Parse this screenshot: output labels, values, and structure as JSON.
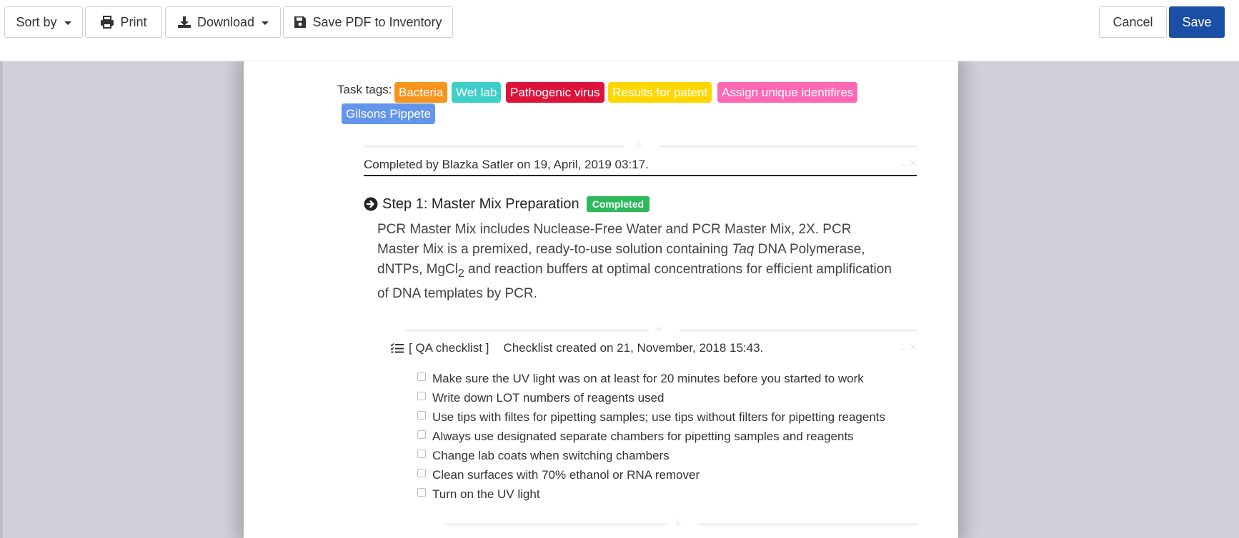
{
  "toolbar": {
    "sort_label": "Sort by",
    "print_label": "Print",
    "download_label": "Download",
    "save_pdf_label": "Save PDF to Inventory",
    "cancel_label": "Cancel",
    "save_label": "Save"
  },
  "task_tags": {
    "label": "Task tags:",
    "items": [
      {
        "label": "Bacteria",
        "color": "#f7941d"
      },
      {
        "label": "Wet lab",
        "color": "#3fcfc9"
      },
      {
        "label": "Pathogenic virus",
        "color": "#dc143c"
      },
      {
        "label": "Results for patent",
        "color": "#ffd700"
      },
      {
        "label": "Assign unique identifires",
        "color": "#ff69b4"
      },
      {
        "label": "Gilsons Pippete",
        "color": "#6495ed"
      }
    ]
  },
  "completion": {
    "text": "Completed by Blazka Satler on 19, April, 2019 03:17."
  },
  "step": {
    "title": "Step 1: Master Mix Preparation",
    "status": "Completed",
    "status_color": "#2eb85c",
    "description": {
      "part1": "PCR Master Mix includes Nuclease-Free Water and PCR Master Mix, 2X. PCR Master Mix is a premixed, ready-to-use solution containing ",
      "italic": "Taq",
      "part2": " DNA Polymerase, dNTPs, MgCl",
      "subscript": "2",
      "part3": " and reaction buffers at optimal concentrations for efficient amplification of DNA templates by PCR."
    }
  },
  "checklist": {
    "name": "[ QA checklist ]",
    "created": "Checklist created on 21, November, 2018 15:43.",
    "items": [
      {
        "label": "Make sure the UV light was on at least for 20 minutes before you started to work",
        "checked": false
      },
      {
        "label": "Write down LOT numbers of reagents used",
        "checked": false
      },
      {
        "label": "Use tips with filtes for pipetting samples; use tips without filters for pipetting reagents",
        "checked": false
      },
      {
        "label": "Always use designated separate chambers for pipetting samples and reagents",
        "checked": false
      },
      {
        "label": "Change lab coats when switching chambers",
        "checked": false
      },
      {
        "label": "Clean surfaces with 70% ethanol or RNA remover",
        "checked": false
      },
      {
        "label": "Turn on the UV light",
        "checked": false
      }
    ]
  },
  "icons": {
    "print": "print-icon",
    "download": "download-icon",
    "save": "floppy-disk-icon",
    "step": "arrow-circle-right-icon",
    "checklist": "tasks-list-icon"
  }
}
